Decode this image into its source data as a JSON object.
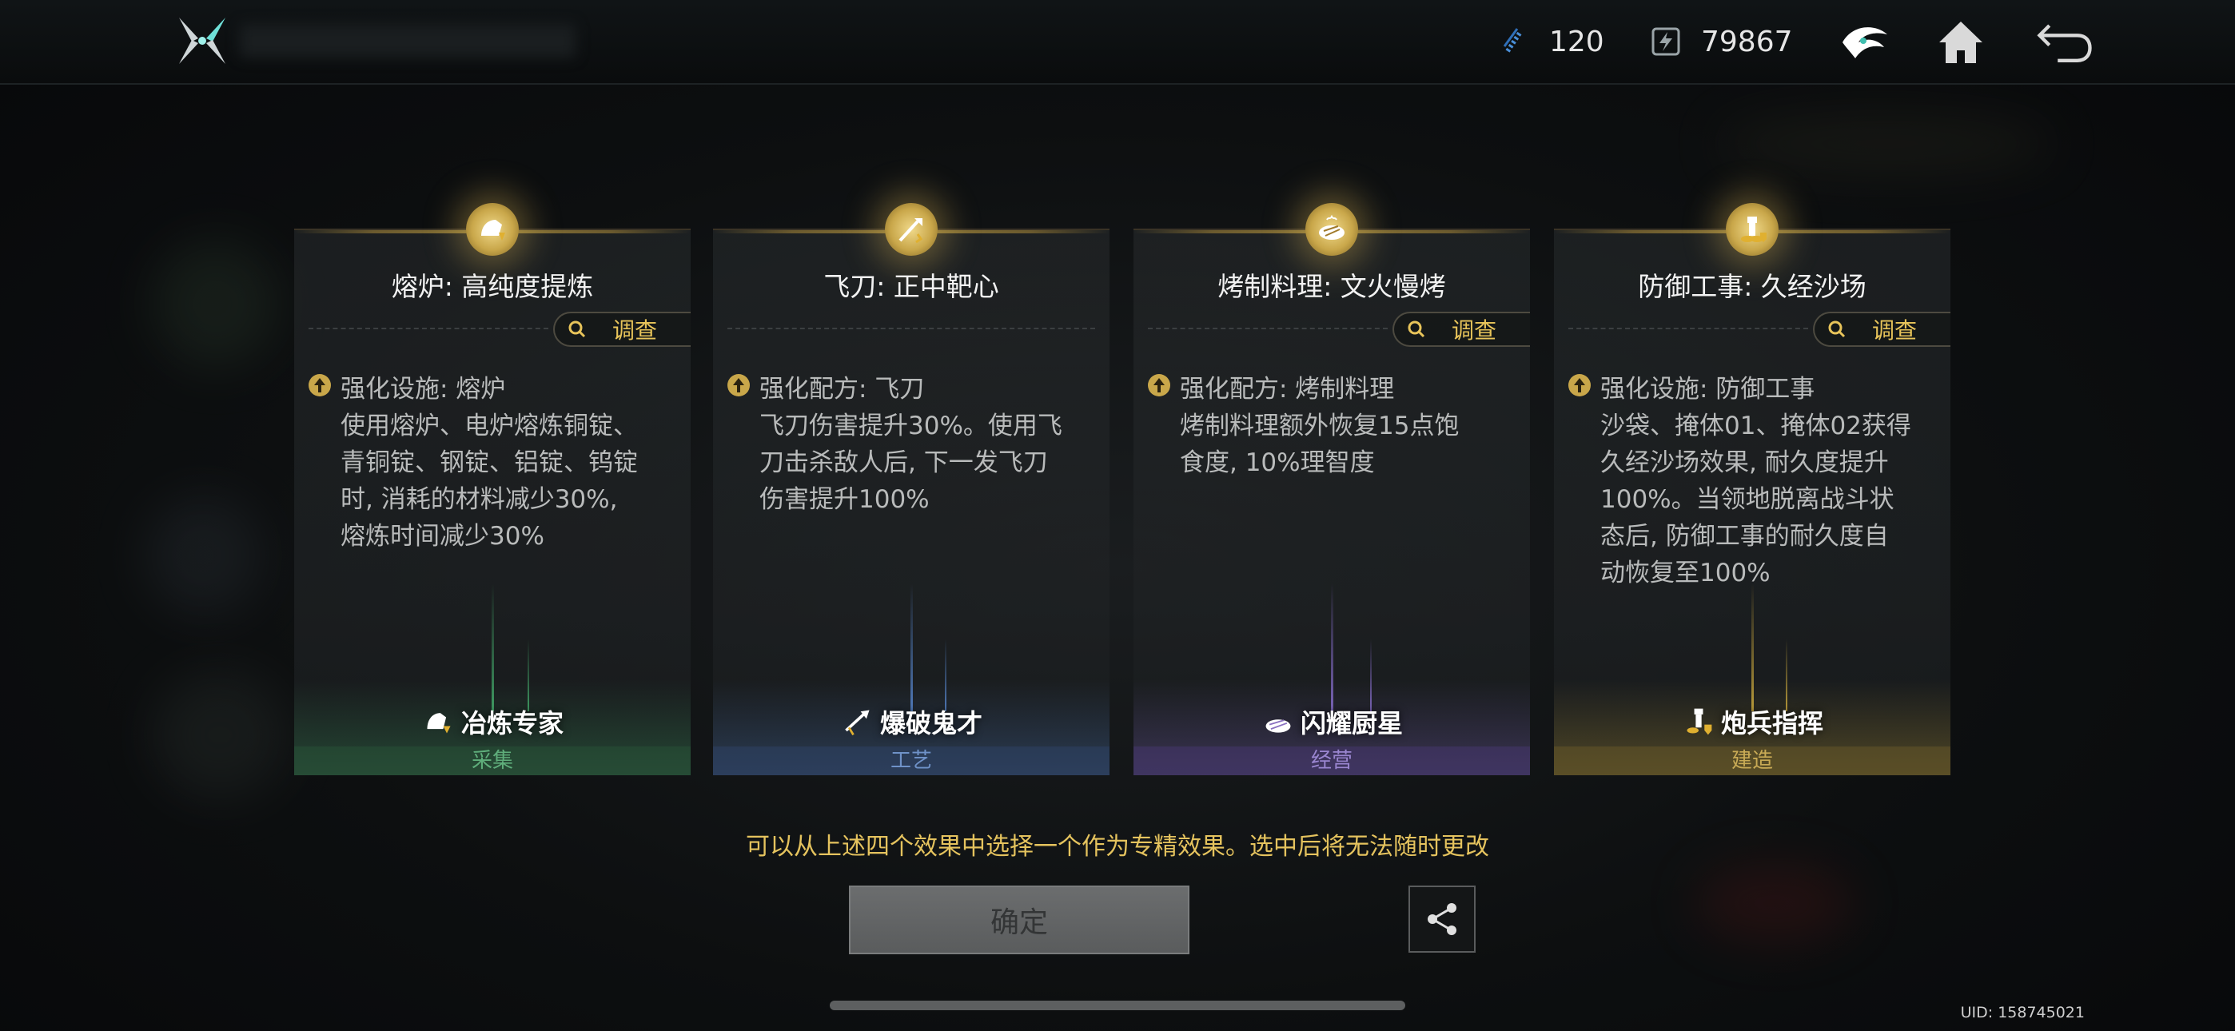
{
  "topbar": {
    "currency1_value": "120",
    "currency2_value": "79867",
    "icons": [
      "crossed-blades-logo-icon",
      "crystal-currency-icon",
      "energy-currency-icon",
      "faction-emblem-icon",
      "home-icon",
      "back-arrow-icon"
    ]
  },
  "cards": [
    {
      "title": "熔炉: 高纯度提炼",
      "investigate": "调查",
      "desc_head": "强化设施: 熔炉",
      "desc_lines": [
        "使用熔炉、电炉熔炼铜锭、",
        "青铜锭、钢锭、铝锭、钨锭",
        "时, 消耗的材料减少30%,",
        "熔炼时间减少30%"
      ],
      "badge": "冶炼专家",
      "category": "采集",
      "accent": "#3f9a62"
    },
    {
      "title": "飞刀: 正中靶心",
      "investigate": "",
      "desc_head": "强化配方: 飞刀",
      "desc_lines": [
        "飞刀伤害提升30%。使用飞",
        "刀击杀敌人后, 下一发飞刀",
        "伤害提升100%"
      ],
      "badge": "爆破鬼才",
      "category": "工艺",
      "accent": "#4f79b8"
    },
    {
      "title": "烤制料理: 文火慢烤",
      "investigate": "调查",
      "desc_head": "强化配方: 烤制料理",
      "desc_lines": [
        "烤制料理额外恢复15点饱",
        "食度, 10%理智度"
      ],
      "badge": "闪耀厨星",
      "category": "经营",
      "accent": "#7a64b8"
    },
    {
      "title": "防御工事: 久经沙场",
      "investigate": "调查",
      "desc_head": "强化设施: 防御工事",
      "desc_lines": [
        "沙袋、掩体01、掩体02获得",
        "久经沙场效果, 耐久度提升",
        "100%。当领地脱离战斗状",
        "态后, 防御工事的耐久度自",
        "动恢复至100%"
      ],
      "badge": "炮兵指挥",
      "category": "建造",
      "accent": "#b89a3a"
    }
  ],
  "hint": "可以从上述四个效果中选择一个作为专精效果。选中后将无法随时更改",
  "confirm_label": "确定",
  "uid": "UID: 158745021"
}
